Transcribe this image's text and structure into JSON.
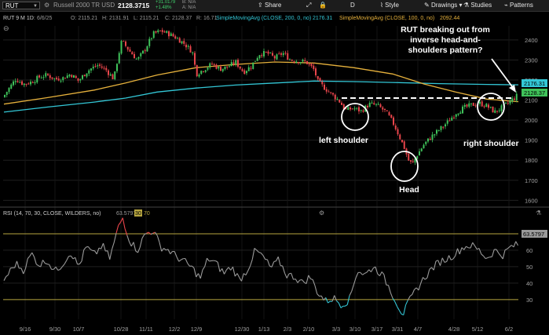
{
  "toolbar": {
    "symbol": "RUT",
    "index_name": "Russell 2000 TR USD",
    "last": "2128.3715",
    "change": "+31.0179",
    "change_pct": "+1.48%",
    "bid": "B: N/A",
    "ask": "A: N/A",
    "share": "Share",
    "period": "D",
    "style": "Style",
    "drawings": "Drawings",
    "studies": "Studies",
    "patterns": "Patterns"
  },
  "ohlc_header": {
    "label": "RUT 9 M 1D",
    "date": "D: 6/6/25",
    "open": "O: 2115.21",
    "high": "H: 2131.91",
    "low": "L: 2115.21",
    "close": "C: 2128.37",
    "range": "R: 16.71",
    "sma200": "SimpleMovingAvg (CLOSE, 200, 0, no)",
    "sma200_value": "2176.31",
    "sma100": "SimpleMovingAvg (CLOSE, 100, 0, no)",
    "sma100_value": "2092.44"
  },
  "rsi_header": {
    "label": "RSI (14, 70, 30, CLOSE, WILDERS, no)",
    "value": "63.5797",
    "level_30": "30",
    "level_70": "70"
  },
  "price_labels": {
    "sma200": "2176.31",
    "last": "2128.37",
    "rsi": "63.5797"
  },
  "annotations": {
    "callout": [
      "RUT breaking out from",
      "inverse head-and-",
      "shoulders pattern?"
    ],
    "left_shoulder": "left shoulder",
    "head": "Head",
    "right_shoulder": "right shoulder"
  },
  "colors": {
    "up": "#3fc25a",
    "down": "#e8454b",
    "sma100": "#e6b13c",
    "sma200": "#33c7d6",
    "rsi": "#9a9a9a",
    "rsi_oversold": "#33c7d6",
    "rsi_overbought": "#e8454b",
    "level_line": "#b7a640"
  },
  "chart_data": {
    "type": "candlestick",
    "x_ticks": [
      "9/16",
      "9/30",
      "10/7",
      "10/28",
      "11/11",
      "12/2",
      "12/9",
      "12/30",
      "1/13",
      "2/3",
      "2/10",
      "3/3",
      "3/10",
      "3/17",
      "3/31",
      "4/7",
      "4/28",
      "5/12",
      "6/2"
    ],
    "y_ticks": [
      1600,
      1700,
      1800,
      1900,
      2000,
      2100,
      2200,
      2300,
      2400
    ],
    "ylim": [
      1570,
      2470
    ],
    "rsi_ticks": [
      30,
      40,
      50,
      60,
      70
    ],
    "rsi_ylim": [
      18,
      80
    ],
    "neckline": 2110,
    "close_path": [
      [
        0,
        2090
      ],
      [
        10,
        2150
      ],
      [
        20,
        2205
      ],
      [
        30,
        2180
      ],
      [
        40,
        2190
      ],
      [
        50,
        2215
      ],
      [
        60,
        2225
      ],
      [
        70,
        2205
      ],
      [
        80,
        2210
      ],
      [
        90,
        2230
      ],
      [
        100,
        2195
      ],
      [
        110,
        2240
      ],
      [
        115,
        2255
      ],
      [
        125,
        2275
      ],
      [
        135,
        2250
      ],
      [
        145,
        2205
      ],
      [
        150,
        2310
      ],
      [
        155,
        2395
      ],
      [
        165,
        2345
      ],
      [
        175,
        2300
      ],
      [
        185,
        2355
      ],
      [
        195,
        2430
      ],
      [
        205,
        2445
      ],
      [
        215,
        2430
      ],
      [
        225,
        2410
      ],
      [
        235,
        2380
      ],
      [
        245,
        2340
      ],
      [
        250,
        2230
      ],
      [
        260,
        2255
      ],
      [
        270,
        2280
      ],
      [
        280,
        2255
      ],
      [
        290,
        2265
      ],
      [
        300,
        2290
      ],
      [
        310,
        2240
      ],
      [
        320,
        2270
      ],
      [
        330,
        2330
      ],
      [
        340,
        2335
      ],
      [
        350,
        2310
      ],
      [
        360,
        2335
      ],
      [
        370,
        2300
      ],
      [
        380,
        2295
      ],
      [
        390,
        2290
      ],
      [
        400,
        2250
      ],
      [
        405,
        2190
      ],
      [
        415,
        2155
      ],
      [
        425,
        2120
      ],
      [
        432,
        2095
      ],
      [
        440,
        2050
      ],
      [
        450,
        2060
      ],
      [
        460,
        2045
      ],
      [
        470,
        2080
      ],
      [
        480,
        2075
      ],
      [
        490,
        2045
      ],
      [
        495,
        2020
      ],
      [
        500,
        1990
      ],
      [
        505,
        1950
      ],
      [
        510,
        1905
      ],
      [
        515,
        1860
      ],
      [
        520,
        1800
      ],
      [
        525,
        1780
      ],
      [
        530,
        1820
      ],
      [
        540,
        1880
      ],
      [
        550,
        1920
      ],
      [
        560,
        1955
      ],
      [
        570,
        1990
      ],
      [
        580,
        2035
      ],
      [
        590,
        2060
      ],
      [
        600,
        2075
      ],
      [
        610,
        2085
      ],
      [
        620,
        2070
      ],
      [
        630,
        2040
      ],
      [
        640,
        2065
      ],
      [
        650,
        2095
      ],
      [
        660,
        2128
      ]
    ],
    "sma100": [
      [
        5,
        2080
      ],
      [
        60,
        2112
      ],
      [
        120,
        2150
      ],
      [
        160,
        2185
      ],
      [
        200,
        2225
      ],
      [
        250,
        2262
      ],
      [
        300,
        2278
      ],
      [
        350,
        2290
      ],
      [
        400,
        2285
      ],
      [
        450,
        2262
      ],
      [
        500,
        2230
      ],
      [
        540,
        2180
      ],
      [
        580,
        2140
      ],
      [
        620,
        2105
      ],
      [
        660,
        2092
      ]
    ],
    "sma200": [
      [
        5,
        2040
      ],
      [
        60,
        2065
      ],
      [
        120,
        2090
      ],
      [
        160,
        2110
      ],
      [
        200,
        2140
      ],
      [
        250,
        2160
      ],
      [
        300,
        2175
      ],
      [
        350,
        2185
      ],
      [
        400,
        2195
      ],
      [
        450,
        2192
      ],
      [
        500,
        2188
      ],
      [
        560,
        2182
      ],
      [
        620,
        2178
      ],
      [
        660,
        2176
      ]
    ],
    "rsi": [
      [
        5,
        42
      ],
      [
        20,
        52
      ],
      [
        30,
        48
      ],
      [
        40,
        58
      ],
      [
        50,
        51
      ],
      [
        60,
        54
      ],
      [
        70,
        47
      ],
      [
        80,
        52
      ],
      [
        90,
        59
      ],
      [
        100,
        50
      ],
      [
        110,
        62
      ],
      [
        120,
        57
      ],
      [
        130,
        63
      ],
      [
        140,
        55
      ],
      [
        150,
        73
      ],
      [
        156,
        80
      ],
      [
        165,
        66
      ],
      [
        175,
        60
      ],
      [
        185,
        70
      ],
      [
        195,
        72
      ],
      [
        205,
        62
      ],
      [
        215,
        60
      ],
      [
        225,
        56
      ],
      [
        235,
        53
      ],
      [
        245,
        49
      ],
      [
        255,
        43
      ],
      [
        265,
        55
      ],
      [
        275,
        52
      ],
      [
        285,
        46
      ],
      [
        295,
        50
      ],
      [
        305,
        42
      ],
      [
        315,
        48
      ],
      [
        325,
        60
      ],
      [
        335,
        56
      ],
      [
        345,
        49
      ],
      [
        355,
        54
      ],
      [
        365,
        45
      ],
      [
        375,
        44
      ],
      [
        385,
        40
      ],
      [
        395,
        44
      ],
      [
        405,
        34
      ],
      [
        415,
        29
      ],
      [
        425,
        31
      ],
      [
        435,
        27
      ],
      [
        445,
        30
      ],
      [
        455,
        48
      ],
      [
        465,
        45
      ],
      [
        475,
        50
      ],
      [
        485,
        46
      ],
      [
        495,
        38
      ],
      [
        505,
        28
      ],
      [
        513,
        21
      ],
      [
        520,
        28
      ],
      [
        530,
        36
      ],
      [
        540,
        43
      ],
      [
        550,
        49
      ],
      [
        560,
        53
      ],
      [
        570,
        55
      ],
      [
        580,
        58
      ],
      [
        590,
        62
      ],
      [
        600,
        63
      ],
      [
        610,
        60
      ],
      [
        620,
        55
      ],
      [
        630,
        60
      ],
      [
        640,
        57
      ],
      [
        650,
        62
      ],
      [
        660,
        63.58
      ]
    ]
  }
}
